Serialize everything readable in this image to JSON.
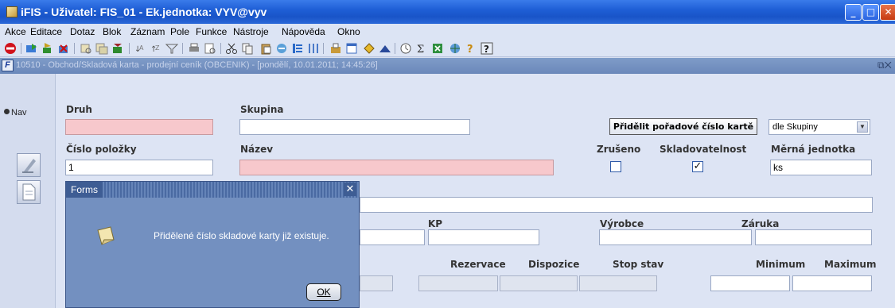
{
  "window": {
    "title": "iFIS - Uživatel: FIS_01 - Ek.jednotka: VYV@vyv"
  },
  "menu": {
    "items": [
      "Akce",
      "Editace",
      "Dotaz",
      "Blok",
      "Záznam",
      "Pole",
      "Funkce",
      "Nástroje",
      "Nápověda",
      "Okno"
    ]
  },
  "inner_window": {
    "title": "10510 - Obchod/Skladová karta - prodejní ceník (OBCENIK) - [pondělí, 10.01.2011; 14:45:26]"
  },
  "sidebar": {
    "nav_label": "Nav"
  },
  "form": {
    "druh_label": "Druh",
    "druh_value": "",
    "skupina_label": "Skupina",
    "skupina_value": "",
    "assign_button": "Přidělit pořadové číslo kartě",
    "assign_mode": "dle Skupiny",
    "cislo_label": "Číslo položky",
    "cislo_value": "1",
    "nazev_label": "Název",
    "nazev_value": "",
    "zruseno_label": "Zrušeno",
    "zruseno_checked": false,
    "sklad_label": "Skladovatelnost",
    "sklad_checked": true,
    "mj_label": "Měrná jednotka",
    "mj_value": "ks",
    "kp_label": "KP",
    "vyrobce_label": "Výrobce",
    "zaruka_label": "Záruka",
    "rezervace_label": "Rezervace",
    "dispozice_label": "Dispozice",
    "stop_label": "Stop stav",
    "minimum_label": "Minimum",
    "maximum_label": "Maximum"
  },
  "dialog": {
    "title": "Forms",
    "message": "Přidělené číslo skladové karty již existuje.",
    "ok_label": "OK",
    "close_glyph": "✕"
  },
  "colors": {
    "required_field": "#f7c8cc",
    "title_bar": "#1f5fd6",
    "dialog_bg": "#7390c0"
  }
}
